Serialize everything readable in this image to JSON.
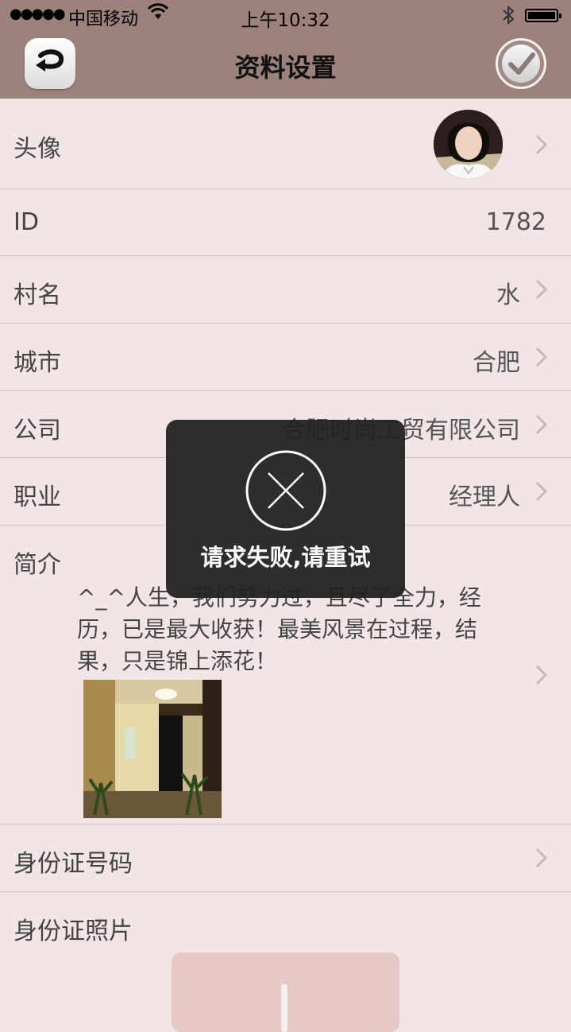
{
  "status_bar": {
    "signal": "●●●●●",
    "carrier": "中国移动",
    "time": "上午10:32"
  },
  "nav": {
    "title": "资料设置"
  },
  "rows": {
    "avatar": {
      "label": "头像"
    },
    "id": {
      "label": "ID",
      "value": "1782"
    },
    "village": {
      "label": "村名",
      "value": "水"
    },
    "city": {
      "label": "城市",
      "value": "合肥"
    },
    "company": {
      "label": "公司",
      "value": "合肥时尚工贸有限公司"
    },
    "job": {
      "label": "职业",
      "value": "经理人"
    },
    "bio": {
      "label": "简介",
      "value": "^_^人生，我们努力过，且尽了全力，经历，已是最大收获！最美风景在过程，结果，只是锦上添花！"
    },
    "id_number": {
      "label": "身份证号码"
    },
    "id_photo": {
      "label": "身份证照片"
    }
  },
  "toast": {
    "message": "请求失败,请重试"
  },
  "icons": {
    "back": "back-arrow-icon",
    "confirm": "checkmark-icon",
    "chevron": "chevron-right-icon",
    "error": "close-circle-icon"
  },
  "colors": {
    "nav_background": "#9c817c",
    "page_background": "#f2e5e5",
    "toast_background": "#222020",
    "upload_box": "#e6c9c6"
  }
}
